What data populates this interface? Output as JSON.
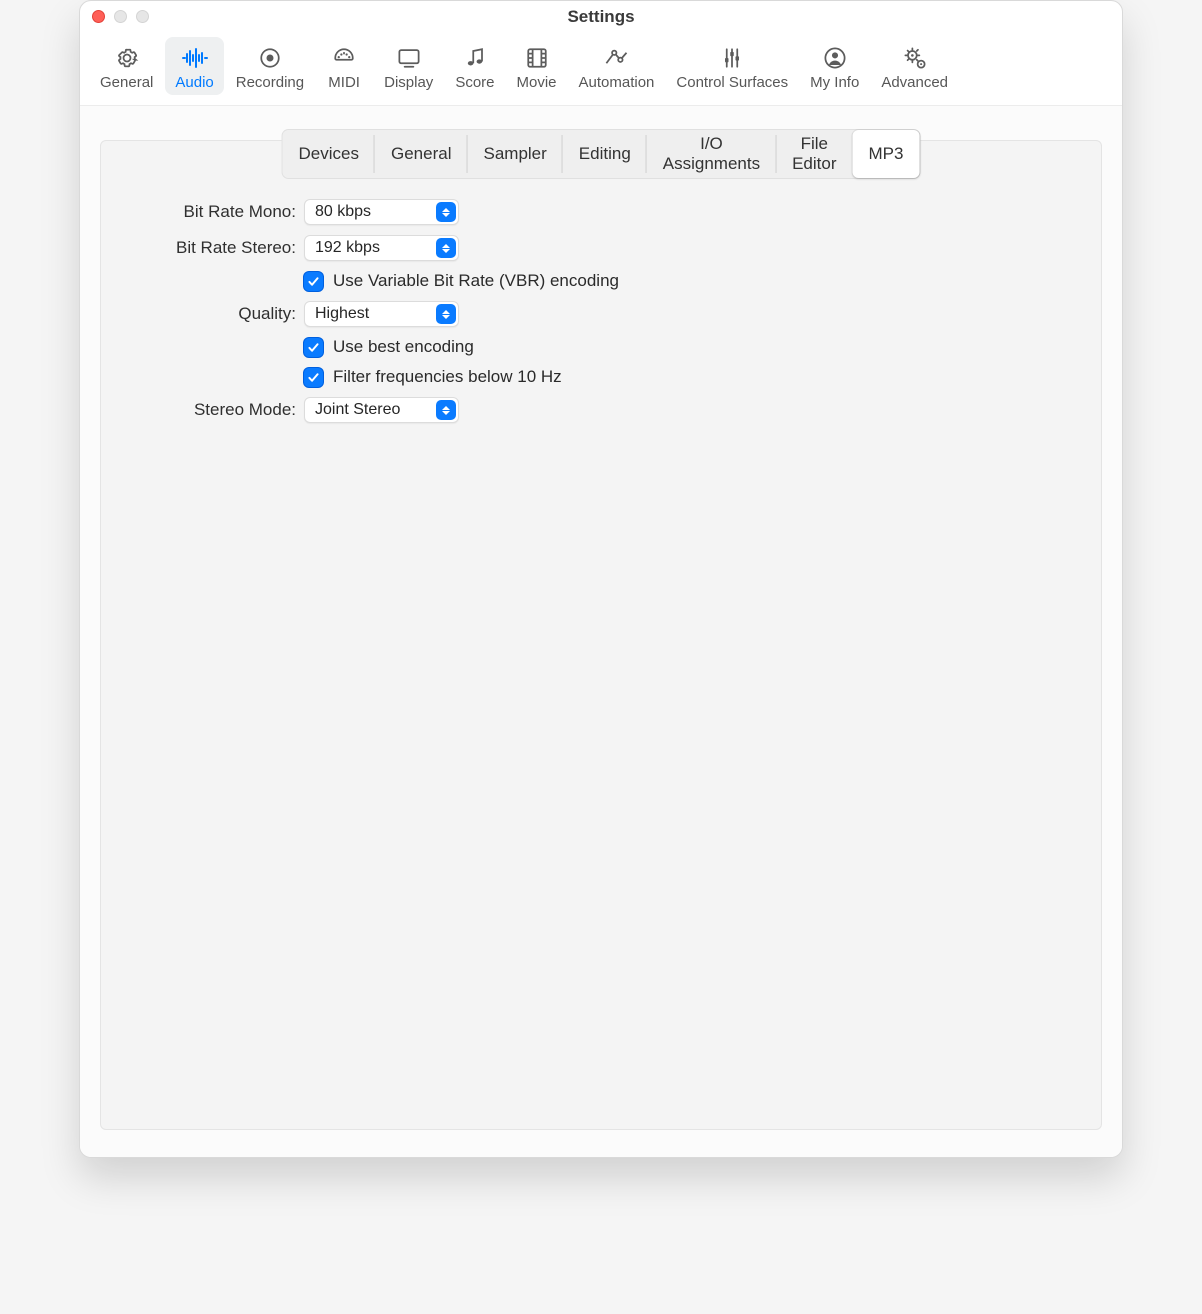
{
  "window": {
    "title": "Settings"
  },
  "toolbar": {
    "items": [
      {
        "id": "general",
        "label": "General"
      },
      {
        "id": "audio",
        "label": "Audio"
      },
      {
        "id": "recording",
        "label": "Recording"
      },
      {
        "id": "midi",
        "label": "MIDI"
      },
      {
        "id": "display",
        "label": "Display"
      },
      {
        "id": "score",
        "label": "Score"
      },
      {
        "id": "movie",
        "label": "Movie"
      },
      {
        "id": "automation",
        "label": "Automation"
      },
      {
        "id": "control-surfaces",
        "label": "Control Surfaces"
      },
      {
        "id": "my-info",
        "label": "My Info"
      },
      {
        "id": "advanced",
        "label": "Advanced"
      }
    ],
    "selected": "audio"
  },
  "subtabs": {
    "items": [
      {
        "id": "devices",
        "label": "Devices"
      },
      {
        "id": "general",
        "label": "General"
      },
      {
        "id": "sampler",
        "label": "Sampler"
      },
      {
        "id": "editing",
        "label": "Editing"
      },
      {
        "id": "io",
        "label": "I/O Assignments"
      },
      {
        "id": "file-editor",
        "label": "File Editor"
      },
      {
        "id": "mp3",
        "label": "MP3"
      }
    ],
    "selected": "mp3"
  },
  "form": {
    "bit_rate_mono_label": "Bit Rate Mono:",
    "bit_rate_mono_value": "80 kbps",
    "bit_rate_stereo_label": "Bit Rate Stereo:",
    "bit_rate_stereo_value": "192 kbps",
    "vbr_checked": true,
    "vbr_label": "Use Variable Bit Rate (VBR) encoding",
    "quality_label": "Quality:",
    "quality_value": "Highest",
    "best_encoding_checked": true,
    "best_encoding_label": "Use best encoding",
    "filter_checked": true,
    "filter_label": "Filter frequencies below 10 Hz",
    "stereo_mode_label": "Stereo Mode:",
    "stereo_mode_value": "Joint Stereo"
  },
  "colors": {
    "accent": "#007aff",
    "pop_arrow_bg": "#0a7bff"
  }
}
